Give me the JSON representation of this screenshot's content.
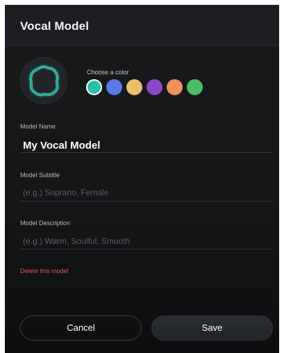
{
  "dialog": {
    "title": "Vocal Model"
  },
  "color_picker": {
    "label": "Choose a color",
    "swatches": [
      {
        "name": "teal",
        "color": "#2bbfac",
        "selected": true
      },
      {
        "name": "blue",
        "color": "#5a78e6",
        "selected": false
      },
      {
        "name": "yellow",
        "color": "#e8c06a",
        "selected": false
      },
      {
        "name": "purple",
        "color": "#8a48c8",
        "selected": false
      },
      {
        "name": "orange",
        "color": "#ec925a",
        "selected": false
      },
      {
        "name": "green",
        "color": "#4dbb68",
        "selected": false
      }
    ]
  },
  "avatar": {
    "icon": "voice-blob-icon",
    "stroke_color": "#2bbfac"
  },
  "fields": {
    "model_name": {
      "label": "Model Name",
      "value": "My Vocal Model"
    },
    "model_subtitle": {
      "label": "Model Subtitle",
      "value": "",
      "placeholder": "(e.g.) Soprano, Female"
    },
    "model_description": {
      "label": "Model Description",
      "value": "",
      "placeholder": "(e.g.) Warm, Soulful, Smooth"
    }
  },
  "actions": {
    "delete_label": "Delete this model",
    "delete_color": "#e5535b",
    "cancel_label": "Cancel",
    "save_label": "Save"
  }
}
